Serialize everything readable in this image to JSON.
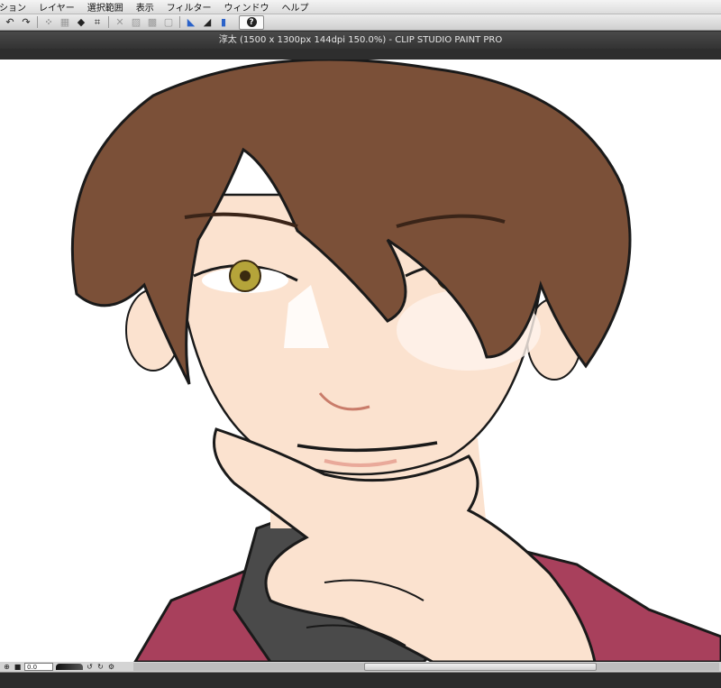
{
  "menu": {
    "items": [
      "ション",
      "レイヤー",
      "選択範囲",
      "表示",
      "フィルター",
      "ウィンドウ",
      "ヘルプ"
    ]
  },
  "toolbar": {
    "icons": [
      "undo-icon",
      "redo-icon",
      "select-transform-icon",
      "clear-icon",
      "fill-icon",
      "crop-icon",
      "snap-ruler-icon",
      "snap-grid-icon",
      "snap-point-icon",
      "help-icon"
    ],
    "help_label": "?"
  },
  "document": {
    "title": "淳太 (1500 x 1300px 144dpi 150.0%)  - CLIP STUDIO PAINT PRO"
  },
  "statusbar": {
    "zoom_value": "0.0"
  },
  "colors": {
    "hair": "#7b5038",
    "skin": "#fbe2cf",
    "jacket": "#a8405c",
    "turtleneck": "#4a4a4a",
    "iris": "#b5a43a"
  }
}
